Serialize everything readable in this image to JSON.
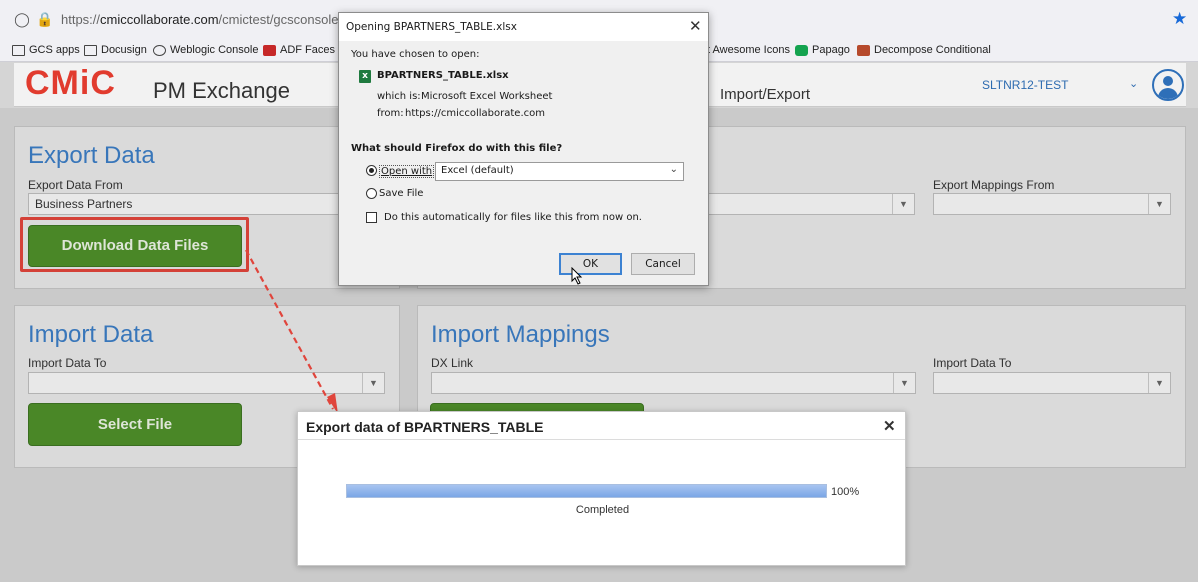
{
  "browser": {
    "url_prefix": "https://",
    "url_domain": "cmiccollaborate.com",
    "url_path": "/cmictest/gcsconsole/face",
    "bookmarks": [
      "GCS apps",
      "Docusign",
      "Weblogic Console",
      "ADF Faces Ri",
      "t Awesome Icons",
      "Papago",
      "Decompose Conditional"
    ]
  },
  "app": {
    "logo": "CMiC",
    "name": "PM Exchange",
    "page": "Import/Export",
    "environment": "SLTNR12-TEST"
  },
  "export_panel": {
    "title": "Export Data",
    "from_label": "Export Data From",
    "from_value": "Business Partners",
    "download_button": "Download Data Files",
    "mappings_label": "Export Mappings From",
    "mappings_value": ""
  },
  "import_panel": {
    "title": "Import Data",
    "to_label": "Import Data To",
    "to_value": "",
    "select_button": "Select File"
  },
  "mappings_panel": {
    "title": "Import Mappings",
    "dx_label": "DX Link",
    "dx_value": "",
    "to_label": "Import Data To",
    "to_value": ""
  },
  "firefox_dialog": {
    "title": "Opening BPARTNERS_TABLE.xlsx",
    "intro": "You have chosen to open:",
    "filename": "BPARTNERS_TABLE.xlsx",
    "which_is_label": "which is:",
    "which_is_value": "Microsoft Excel Worksheet",
    "from_label": "from:",
    "from_value": "https://cmiccollaborate.com",
    "question": "What should Firefox do with this file?",
    "open_with_label": "Open with",
    "open_with_value": "Excel (default)",
    "save_file_label": "Save File",
    "auto_label": "Do this automatically for files like this from now on.",
    "ok_label": "OK",
    "cancel_label": "Cancel"
  },
  "export_modal": {
    "title": "Export data of BPARTNERS_TABLE",
    "progress": 1.0,
    "percent_label": "100%",
    "status": "Completed"
  }
}
